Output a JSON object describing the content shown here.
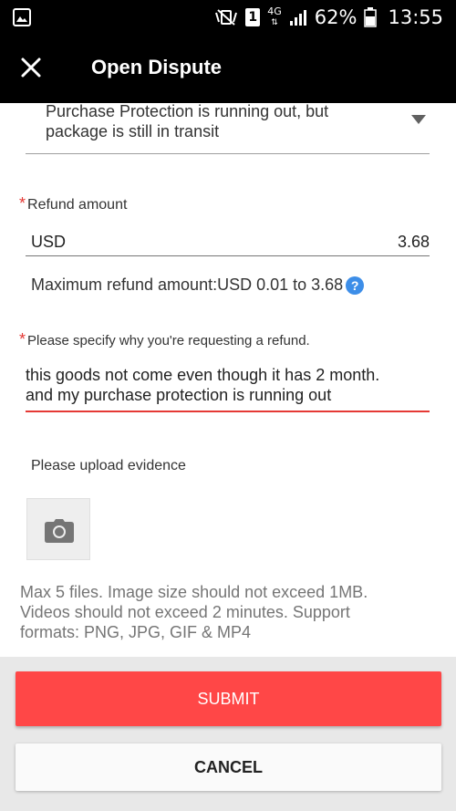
{
  "status_bar": {
    "gallery_icon": "image-icon",
    "mute_icon": "vibrate-mute-icon",
    "sim_label": "1",
    "network_label": "4G",
    "signal_icon": "signal-icon",
    "battery_percent": "62%",
    "battery_icon": "battery-icon",
    "time": "13:55"
  },
  "app_bar": {
    "close_icon": "close-icon",
    "title": "Open Dispute"
  },
  "form": {
    "reason_select": {
      "line1": "Purchase Protection is running out, but",
      "line2": "package is still in transit"
    },
    "refund_amount": {
      "required_star": "*",
      "label": "Refund amount",
      "currency": "USD",
      "value": "3.68",
      "max_text": "Maximum refund amount:USD 0.01 to 3.68",
      "help_icon_glyph": "?"
    },
    "refund_reason": {
      "required_star": "*",
      "label": "Please specify why you're requesting a refund.",
      "line1": "this goods not come even though it has 2 month.",
      "line2": "and my purchase protection is running out"
    },
    "evidence": {
      "label": "Please upload evidence",
      "info_line1": "Max 5 files. Image size should not exceed 1MB.",
      "info_line2": "Videos should not exceed 2 minutes. Support",
      "info_line3": "formats: PNG, JPG, GIF & MP4"
    }
  },
  "actions": {
    "submit_label": "SUBMIT",
    "cancel_label": "CANCEL"
  },
  "colors": {
    "accent": "#ff4747",
    "required": "#e53935",
    "help": "#3d8ee8",
    "status_bar": "#000000"
  }
}
